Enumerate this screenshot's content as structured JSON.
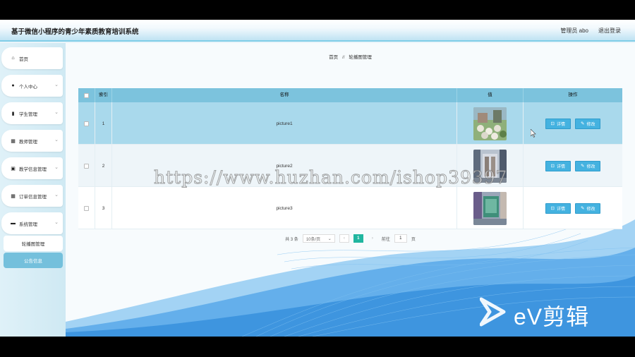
{
  "header": {
    "title": "基于微信小程序的青少年素质教育培训系统",
    "user": "管理员 abo",
    "logout": "退出登录"
  },
  "sidebar": {
    "items": [
      {
        "label": "首页",
        "icon": "home-icon",
        "has_chevron": false
      },
      {
        "label": "个人中心",
        "icon": "user-icon",
        "has_chevron": true
      },
      {
        "label": "学生管理",
        "icon": "clipboard-icon",
        "has_chevron": true
      },
      {
        "label": "教师管理",
        "icon": "grid-icon",
        "has_chevron": true
      },
      {
        "label": "教学信息管理",
        "icon": "book-icon",
        "has_chevron": true
      },
      {
        "label": "订单信息管理",
        "icon": "grid-icon",
        "has_chevron": true
      },
      {
        "label": "系统管理",
        "icon": "briefcase-icon",
        "has_chevron": true
      }
    ],
    "sub_items": [
      {
        "label": "轮播图管理",
        "active": false
      },
      {
        "label": "公告信息",
        "active": true
      }
    ]
  },
  "breadcrumb": {
    "home": "首页",
    "separator": "//",
    "current": "轮播图管理"
  },
  "table": {
    "columns": [
      "索引",
      "名称",
      "值",
      "操作"
    ],
    "rows": [
      {
        "index": "1",
        "name": "picture1",
        "image": "garden-photo"
      },
      {
        "index": "2",
        "name": "picture2",
        "image": "corridor-photo"
      },
      {
        "index": "3",
        "name": "picture3",
        "image": "classroom-photo"
      }
    ],
    "detail_label": "详情",
    "edit_label": "修改"
  },
  "pagination": {
    "total": "共 3 条",
    "page_size": "10条/页",
    "current_page": "1",
    "goto_prefix": "前往",
    "goto_value": "1",
    "goto_suffix": "页"
  },
  "overlay": {
    "watermark": "https://www.huzhan.com/ishop39397",
    "brand": "eV剪辑"
  },
  "colors": {
    "accent": "#74c0dc",
    "table_header": "#7cc3dd",
    "button": "#44b2e0",
    "pager_active": "#20b6a0"
  }
}
